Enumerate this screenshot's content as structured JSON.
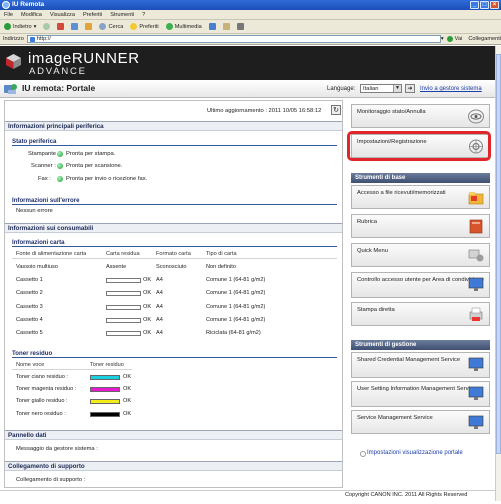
{
  "window": {
    "title": "IU Remota"
  },
  "menubar": {
    "items": [
      "File",
      "Modifica",
      "Visualizza",
      "Preferiti",
      "Strumenti",
      "?"
    ]
  },
  "toolbar": {
    "back": "Indietro",
    "search": "Cerca",
    "favorites": "Preferiti",
    "multimedia": "Multimedia"
  },
  "addressbar": {
    "label": "Indirizzo",
    "url": "http://",
    "go": "Vai",
    "links": "Collegamenti"
  },
  "header": {
    "brand_title": "imageRUNNER",
    "brand_sub": "ADVANCE",
    "page_title": "IU remota: Portale",
    "language_label": "Language:",
    "language_value": "Italian",
    "admin_link": "Invio a gestore sistema"
  },
  "updated": "Ultimo aggiornamento : 2011 10/05 16:58:12",
  "device": {
    "section": "Informazioni principali periferica",
    "status_title": "Stato periferica",
    "status": [
      {
        "label": "Stampante :",
        "value": "Pronta per stampa."
      },
      {
        "label": "Scanner :",
        "value": "Pronta per scansione."
      },
      {
        "label": "Fax :",
        "value": "Pronta per invio o ricezione fax."
      }
    ],
    "error_title": "Informazioni sull'errore",
    "error_value": "Nessun errore"
  },
  "consumables": {
    "section": "Informazioni sui consumabili",
    "paper_title": "Informazioni carta",
    "paper_headers": [
      "Fonte di alimentazione carta",
      "Carta residua",
      "Formato carta",
      "Tipo di carta"
    ],
    "paper_rows": [
      {
        "source": "Vassoio multiuso",
        "level_text": "Assente",
        "format": "Sconosciuto",
        "type": "Non definito"
      },
      {
        "source": "Cassetto 1",
        "level_text": "OK",
        "format": "A4",
        "type": "Comune 1 (64-81 g/m2)"
      },
      {
        "source": "Cassetto 2",
        "level_text": "OK",
        "format": "A4",
        "type": "Comune 1 (64-81 g/m2)"
      },
      {
        "source": "Cassetto 3",
        "level_text": "OK",
        "format": "A4",
        "type": "Comune 1 (64-81 g/m2)"
      },
      {
        "source": "Cassetto 4",
        "level_text": "OK",
        "format": "A4",
        "type": "Comune 1 (64-81 g/m2)"
      },
      {
        "source": "Cassetto 5",
        "level_text": "OK",
        "format": "A4",
        "type": "Riciclata (64-81 g/m2)"
      }
    ],
    "toner_title": "Toner residuo",
    "toner_headers": [
      "Nome voce",
      "Toner residuo"
    ],
    "toner_rows": [
      {
        "name": "Toner ciano residuo :",
        "color": "#1ad0e0",
        "status": "OK"
      },
      {
        "name": "Toner magenta residuo :",
        "color": "#e81ad0",
        "status": "OK"
      },
      {
        "name": "Toner giallo residuo :",
        "color": "#f3ec18",
        "status": "OK"
      },
      {
        "name": "Toner nero residuo :",
        "color": "#000000",
        "status": "OK"
      }
    ]
  },
  "bulletin": {
    "section": "Pannello dati",
    "text": "Messaggio da gestore sistema :"
  },
  "support": {
    "section": "Collegamento di supporto",
    "text": "Collegamento di supporto :"
  },
  "right": {
    "monitor": "Monitoraggio stato/Annulla",
    "settings": "Impostazioni/Registrazione",
    "basic_title": "Strumenti di base",
    "basic": [
      "Accesso a file ricevuti/memorizzati",
      "Rubrica",
      "Quick Menu",
      "Controllo accesso utente per Area di condivisione",
      "Stampa diretta"
    ],
    "mgmt_title": "Strumenti di gestione",
    "mgmt": [
      "Shared Credential Management Service",
      "User Setting Information Management Service",
      "Service Management Service"
    ],
    "display_settings": "Impostazioni visualizzazione portale"
  },
  "footer": {
    "copyright": "Copyright CANON INC. 2011 All Rights Reserved"
  },
  "colors": {
    "accent": "#e0262b",
    "brand_bg": "#1e1e1e",
    "status_ok": "#1f9c3d"
  }
}
